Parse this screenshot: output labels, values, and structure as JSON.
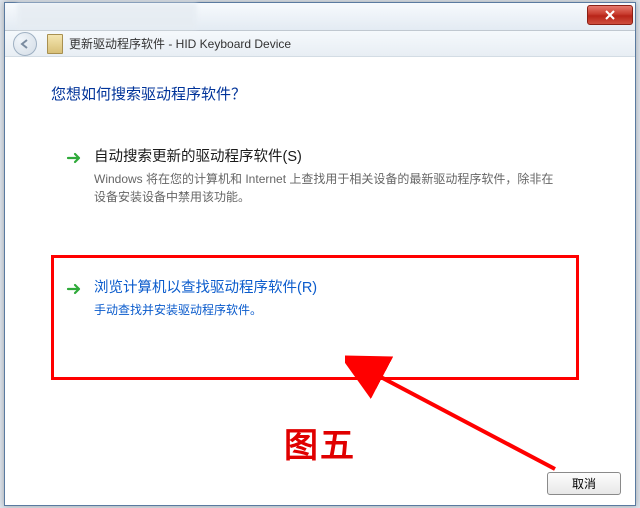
{
  "titlebar": {
    "close_tooltip": "Close"
  },
  "header": {
    "title": "更新驱动程序软件 - HID Keyboard Device"
  },
  "main": {
    "heading": "您想如何搜索驱动程序软件？"
  },
  "options": {
    "auto": {
      "title": "自动搜索更新的驱动程序软件(S)",
      "desc": "Windows 将在您的计算机和 Internet 上查找用于相关设备的最新驱动程序软件，除非在设备安装设备中禁用该功能。"
    },
    "browse": {
      "title": "浏览计算机以查找驱动程序软件(R)",
      "desc": "手动查找并安装驱动程序软件。"
    }
  },
  "footer": {
    "cancel_label": "取消"
  },
  "annotation": {
    "figure_label": "图五"
  }
}
